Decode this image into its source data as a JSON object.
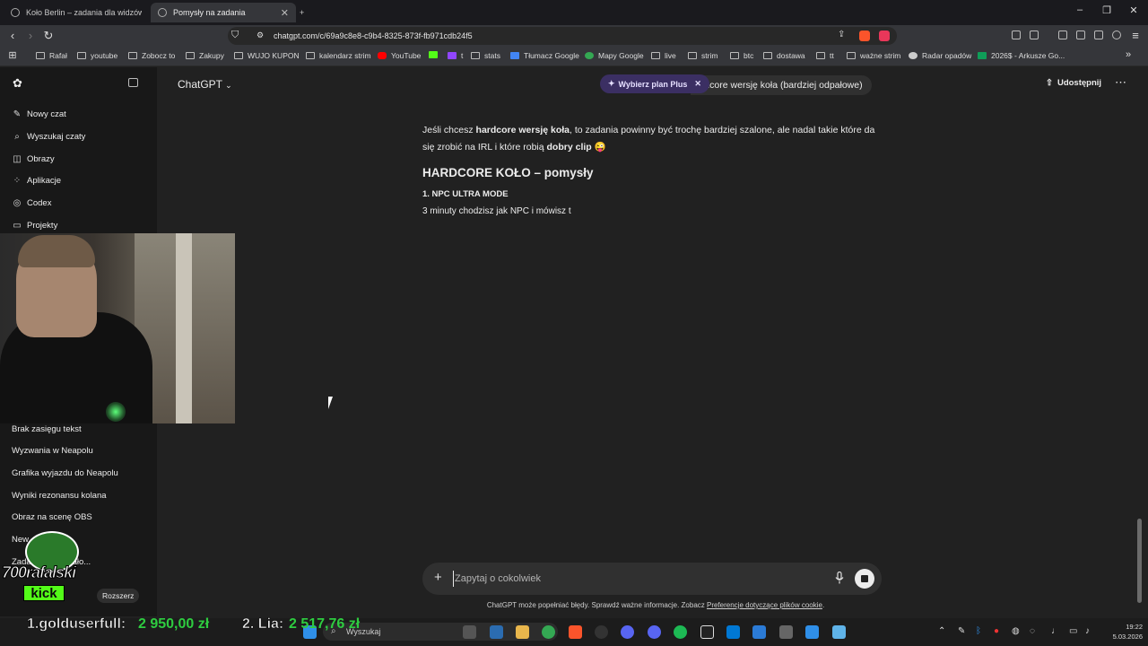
{
  "browser": {
    "tabs": [
      {
        "title": "Koło Berlin – zadania dla widzów – Gi",
        "active": false
      },
      {
        "title": "Pomysły na zadania",
        "active": true
      }
    ],
    "new_tab": "+",
    "url": "chatgpt.com/c/69a9c8e8-c9b4-8325-873f-fb971cdb24f5",
    "bookmarks": [
      {
        "label": "Rafał",
        "icon": "folder-icon"
      },
      {
        "label": "youtube",
        "icon": "folder-icon"
      },
      {
        "label": "Zobocz to",
        "icon": "folder-icon"
      },
      {
        "label": "Zakupy",
        "icon": "folder-icon"
      },
      {
        "label": "WUJO KUPON",
        "icon": "folder-icon"
      },
      {
        "label": "kalendarz strim",
        "icon": "folder-icon"
      },
      {
        "label": "YouTube",
        "icon": "youtube-icon"
      },
      {
        "label": "",
        "icon": "kick-icon"
      },
      {
        "label": "t",
        "icon": "twitch-icon"
      },
      {
        "label": "stats",
        "icon": "folder-icon"
      },
      {
        "label": "Tłumacz Google",
        "icon": "translate-icon"
      },
      {
        "label": "Mapy Google",
        "icon": "maps-icon"
      },
      {
        "label": "live",
        "icon": "folder-icon"
      },
      {
        "label": "strim",
        "icon": "folder-icon"
      },
      {
        "label": "btc",
        "icon": "folder-icon"
      },
      {
        "label": "dostawa",
        "icon": "folder-icon"
      },
      {
        "label": "tt",
        "icon": "folder-icon"
      },
      {
        "label": "ważne strim",
        "icon": "folder-icon"
      },
      {
        "label": "Radar opadów",
        "icon": "radar-icon"
      },
      {
        "label": "2026$ - Arkusze Go...",
        "icon": "sheets-icon"
      }
    ]
  },
  "sidebar": {
    "items": [
      {
        "label": "Nowy czat",
        "icon": "edit-icon"
      },
      {
        "label": "Wyszukaj czaty",
        "icon": "search-icon"
      },
      {
        "label": "Obrazy",
        "icon": "image-icon"
      },
      {
        "label": "Aplikacje",
        "icon": "apps-icon"
      },
      {
        "label": "Codex",
        "icon": "codex-icon"
      },
      {
        "label": "Projekty",
        "icon": "folder-icon"
      }
    ],
    "chats": [
      "Brak zasięgu tekst",
      "Wyzwania w Neapolu",
      "Grafika wyjazdu do Neapolu",
      "Wyniki rezonansu kolana",
      "Obraz na scenę OBS",
      "New ...",
      "Zadania ... Michało..."
    ],
    "rozszerz": "Rozszerz"
  },
  "header": {
    "model": "ChatGPT",
    "upgrade": "Wybierz plan Plus",
    "chat_title": "ardcore wersję koła (bardziej odpałowe)",
    "share": "Udostępnij"
  },
  "message": {
    "intro_1": "Jeśli chcesz ",
    "intro_b1": "hardcore wersję koła",
    "intro_2": ", to zadania powinny być trochę bardziej szalone, ale nadal takie które da",
    "intro_3": "się zrobić na IRL i które robią ",
    "intro_b2": "dobry clip",
    "intro_emoji": "😜",
    "heading": "HARDCORE KOŁO – pomysły",
    "item_title": "1. NPC ULTRA MODE",
    "item_text": "3 minuty chodzisz jak NPC i mówisz t"
  },
  "composer": {
    "placeholder": "Zapytaj o cokolwiek"
  },
  "disclaimer": {
    "text": "ChatGPT może popełniać błędy. Sprawdź ważne informacje. Zobacz ",
    "link": "Preferencje dotyczące plików cookie",
    "end": "."
  },
  "overlay": {
    "channel": "700rafalski",
    "platform": "kick",
    "leader_1_name": "1.golduserfull:",
    "leader_1_amount": "2 950,00 zł",
    "leader_2_name": "2. Lia:",
    "leader_2_amount": "2 517,76 zł"
  },
  "taskbar": {
    "search_placeholder": "Wyszukaj",
    "time": "19:22",
    "date": "5.03.2026"
  },
  "colors": {
    "background": "#212121",
    "sidebar": "#181818",
    "upgrade_bg": "#3b2f63",
    "kick_green": "#53fc18"
  }
}
